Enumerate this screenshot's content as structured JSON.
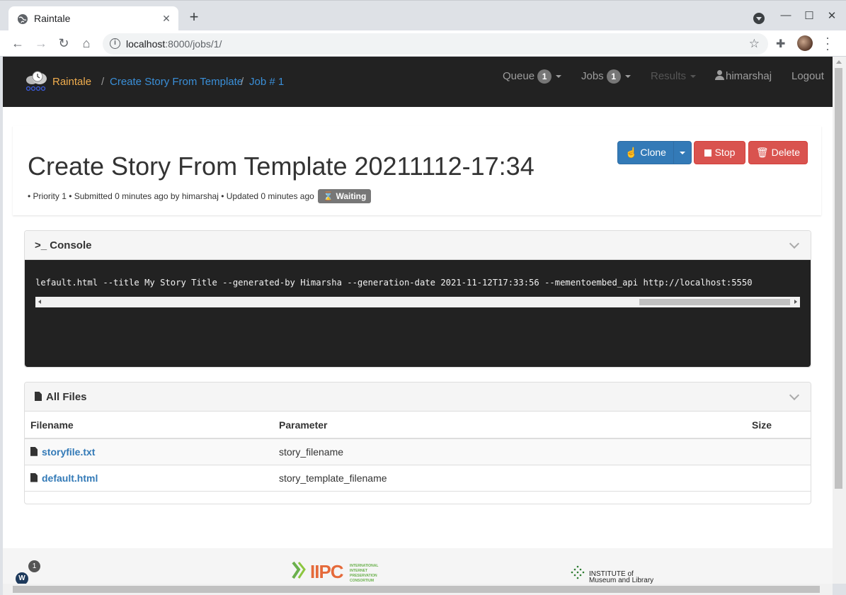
{
  "browser": {
    "tab_title": "Raintale",
    "url_host": "localhost",
    "url_rest": ":8000/jobs/1/"
  },
  "navbar": {
    "brand": "Raintale",
    "breadcrumbs": [
      "Create Story From Template",
      "Job # 1"
    ],
    "separator": "/",
    "queue_label": "Queue",
    "queue_count": "1",
    "jobs_label": "Jobs",
    "jobs_count": "1",
    "results_label": "Results",
    "user": "himarshaj",
    "logout": "Logout"
  },
  "job": {
    "title": "Create Story From Template 20211112-17:34",
    "meta": "• Priority 1 • Submitted 0 minutes ago by himarshaj • Updated 0 minutes ago",
    "status": "Waiting",
    "clone_label": "Clone",
    "stop_label": "Stop",
    "delete_label": "Delete"
  },
  "console": {
    "title": "Console",
    "line": "lefault.html --title My Story Title --generated-by Himarsha --generation-date 2021-11-12T17:33:56 --mementoembed_api http://localhost:5550"
  },
  "files": {
    "title": "All Files",
    "columns": [
      "Filename",
      "Parameter",
      "Size"
    ],
    "rows": [
      {
        "filename": "storyfile.txt",
        "parameter": "story_filename",
        "size": ""
      },
      {
        "filename": "default.html",
        "parameter": "story_template_filename",
        "size": ""
      }
    ]
  },
  "footer": {
    "w_label": "W",
    "badge": "1",
    "iipc": "IIPC",
    "iipc_sub": "INTERNATIONAL INTERNET PRESERVATION CONSORTIUM",
    "imls": "INSTITUTE of Museum and Library"
  },
  "colors": {
    "navbar_bg": "#222222",
    "brand": "#f0ad4e",
    "link": "#337ab7",
    "danger": "#d9534f",
    "status_label": "#777777"
  }
}
